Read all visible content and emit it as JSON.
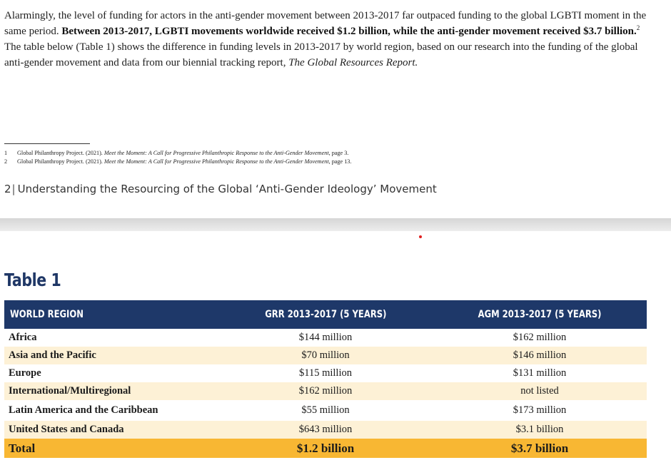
{
  "paragraph": {
    "part1": "Alarmingly, the level of funding for actors in the anti-gender movement between 2013-2017 far outpaced funding to the global LGBTI moment in the same period. ",
    "bold": "Between 2013-2017, LGBTI movements worldwide received $1.2 billion, while the anti-gender movement received $3.7 billion.",
    "sup": "2",
    "part2": " The table below (Table 1) shows the difference in funding levels in 2013-2017 by world region, based on our research into the funding of the global anti-gender movement and data from our biennial tracking report, ",
    "report_title": "The Global Resources Report.",
    "part3": ""
  },
  "footnotes": [
    {
      "number": "1",
      "prefix": "Global Philanthropy Project. (2021). ",
      "title": "Meet the Moment: A Call for Progressive Philanthropic Response to the Anti-Gender Movement",
      "suffix": ", page 3."
    },
    {
      "number": "2",
      "prefix": "Global Philanthropy Project. (2021). ",
      "title": "Meet the Moment: A Call for Progressive Philanthropic Response to the Anti-Gender Movement",
      "suffix": ", page 13."
    }
  ],
  "page_footer": {
    "page_number": "2",
    "separator": "|",
    "title": "Understanding the Resourcing of the Global ‘Anti-Gender Ideology’ Movement"
  },
  "table": {
    "title": "Table 1",
    "headers": [
      "WORLD REGION",
      "GRR 2013-2017 (5 YEARS)",
      "AGM 2013-2017 (5 YEARS)"
    ],
    "rows": [
      {
        "region": "Africa",
        "grr": "$144 million",
        "agm": "$162 million"
      },
      {
        "region": "Asia and the Pacific",
        "grr": "$70 million",
        "agm": "$146 million"
      },
      {
        "region": "Europe",
        "grr": "$115 million",
        "agm": "$131 million"
      },
      {
        "region": "International/Multiregional",
        "grr": "$162 million",
        "agm": "not listed"
      },
      {
        "region": "Latin America and the Caribbean",
        "grr": "$55 million",
        "agm": "$173 million"
      },
      {
        "region": "United States and Canada",
        "grr": "$643 million",
        "agm": "$3.1 billion"
      }
    ],
    "total": {
      "region": "Total",
      "grr": "$1.2 billion",
      "agm": "$3.7 billion"
    }
  },
  "colors": {
    "header_bg": "#1e3869",
    "shaded_row": "#fdf1d6",
    "total_row": "#f8b733",
    "title": "#1f3766"
  }
}
